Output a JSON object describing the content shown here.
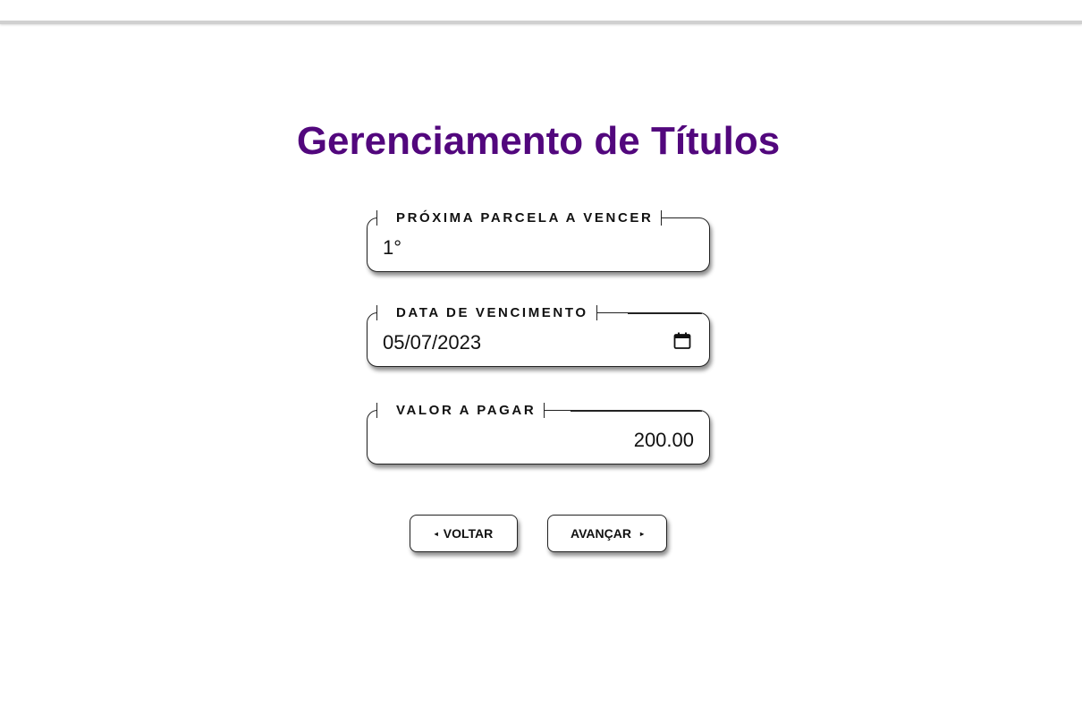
{
  "page": {
    "title": "Gerenciamento de Títulos"
  },
  "fields": {
    "installment": {
      "label": "PRÓXIMA PARCELA A VENCER",
      "value": "1°"
    },
    "due_date": {
      "label": "DATA DE VENCIMENTO",
      "value": "05/07/2023",
      "icon": "calendar-icon"
    },
    "amount": {
      "label": "VALOR A PAGAR",
      "value": "200.00"
    }
  },
  "buttons": {
    "back_label": "VOLTAR",
    "back_icon": "◂",
    "next_label": "AVANÇAR",
    "next_icon": "▸"
  },
  "colors": {
    "title": "#52077d"
  }
}
